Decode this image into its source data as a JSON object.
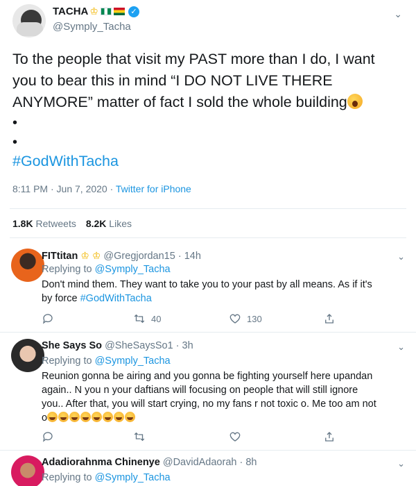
{
  "main_tweet": {
    "display_name": "TACHA",
    "handle": "@Symply_Tacha",
    "text_lines": [
      "To the people that visit my PAST more than I do, I want",
      "you to bear this in mind “I DO NOT LIVE THERE",
      "ANYMORE” matter of fact I sold the whole building"
    ],
    "bullets": [
      "•",
      "•"
    ],
    "hashtag": "#GodWithTacha",
    "timestamp": "8:11 PM · Jun 7, 2020 · ",
    "source": "Twitter for iPhone",
    "retweets_count": "1.8K",
    "retweets_label": "Retweets",
    "likes_count": "8.2K",
    "likes_label": "Likes"
  },
  "replies": [
    {
      "display_name": "FITtitan",
      "handle": "@Gregjordan15 · 14h",
      "replying_label": "Replying to ",
      "replying_to": "@Symply_Tacha",
      "body_lines": [
        "Don't mind them. They want to take you to your past by all means. As if it's",
        "by force "
      ],
      "body_tag": "#GodWithTacha",
      "retweets": "40",
      "likes": "130"
    },
    {
      "display_name": "She Says So",
      "handle": "@SheSaysSo1 · 3h",
      "replying_label": "Replying to ",
      "replying_to": "@Symply_Tacha",
      "body_lines": [
        "Reunion gonna be airing and you gonna be fighting yourself here upandan",
        "again.. N you n your daftians will focusing on people that will still ignore",
        "you.. After that, you will start crying, no my fans r not toxic o. Me too am not",
        "o"
      ],
      "retweets": "",
      "likes": ""
    },
    {
      "display_name": "Adadiorahnma Chinenye",
      "handle": "@DavidAdaorah · 8h",
      "replying_label": "Replying to ",
      "replying_to": "@Symply_Tacha"
    }
  ],
  "icons": {
    "verified": "verified-badge-icon",
    "caret": "chevron-down-icon",
    "reply": "reply-bubble-icon",
    "retweet": "retweet-icon",
    "like": "heart-icon",
    "share": "share-icon"
  },
  "colors": {
    "accent": "#1b95e0",
    "muted": "#657786",
    "text": "#14171a",
    "verified": "#1da1f2"
  }
}
